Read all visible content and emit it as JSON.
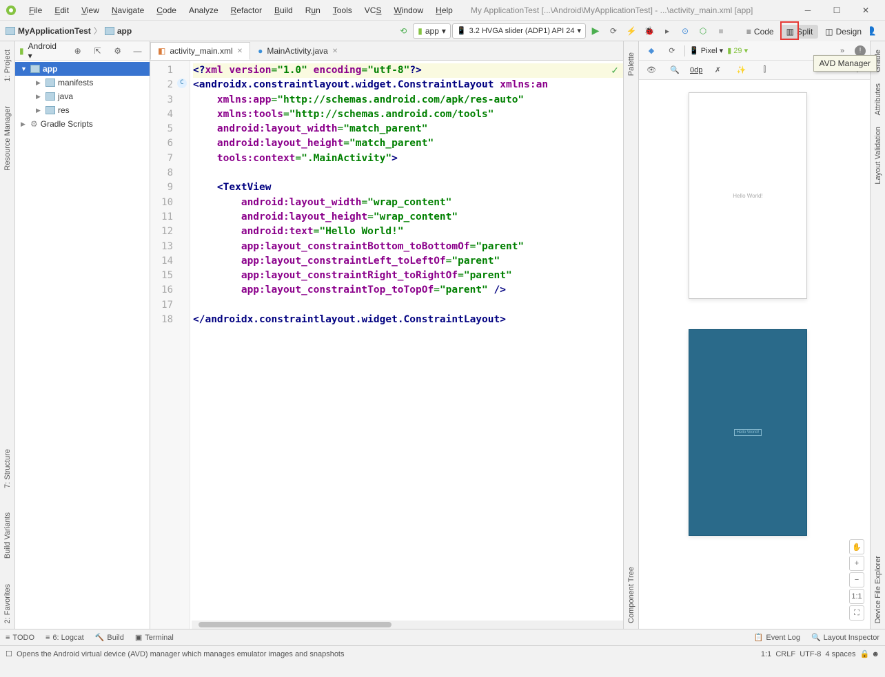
{
  "menu": {
    "file": "File",
    "edit": "Edit",
    "view": "View",
    "navigate": "Navigate",
    "code": "Code",
    "analyze": "Analyze",
    "refactor": "Refactor",
    "build": "Build",
    "run": "Run",
    "tools": "Tools",
    "vcs": "VCS",
    "window": "Window",
    "help": "Help"
  },
  "window_title": "My ApplicationTest [...\\Android\\MyApplicationTest] - ...\\activity_main.xml [app]",
  "breadcrumb": {
    "root": "MyApplicationTest",
    "module": "app"
  },
  "run_config": "app",
  "device": "3.2  HVGA slider (ADP1)  API 24",
  "tooltip": "AVD Manager",
  "project": {
    "scope": "Android",
    "root": "app",
    "children": [
      "manifests",
      "java",
      "res"
    ],
    "gradle": "Gradle Scripts"
  },
  "tabs": [
    {
      "name": "activity_main.xml",
      "active": true
    },
    {
      "name": "MainActivity.java",
      "active": false
    }
  ],
  "view_tabs": {
    "code": "Code",
    "split": "Split",
    "design": "Design"
  },
  "lines": [
    "1",
    "2",
    "3",
    "4",
    "5",
    "6",
    "7",
    "8",
    "9",
    "10",
    "11",
    "12",
    "13",
    "14",
    "15",
    "16",
    "17",
    "18"
  ],
  "code": {
    "l1_a": "<?",
    "l1_b": "xml version",
    "l1_c": "=",
    "l1_d": "\"1.0\"",
    "l1_e": " encoding",
    "l1_f": "=",
    "l1_g": "\"utf-8\"",
    "l1_h": "?>",
    "l2_a": "<",
    "l2_b": "androidx.constraintlayout.widget.ConstraintLayout",
    "l2_c": " xmlns:an",
    "l3_a": "    xmlns:app",
    "l3_b": "=",
    "l3_c": "\"http://schemas.android.com/apk/res-auto\"",
    "l4_a": "    xmlns:tools",
    "l4_b": "=",
    "l4_c": "\"http://schemas.android.com/tools\"",
    "l5_a": "    android:layout_width",
    "l5_b": "=",
    "l5_c": "\"match_parent\"",
    "l6_a": "    android:layout_height",
    "l6_b": "=",
    "l6_c": "\"match_parent\"",
    "l7_a": "    tools:context",
    "l7_b": "=",
    "l7_c": "\".MainActivity\"",
    "l7_d": ">",
    "l9_a": "    <",
    "l9_b": "TextView",
    "l10_a": "        android:layout_width",
    "l10_b": "=",
    "l10_c": "\"wrap_content\"",
    "l11_a": "        android:layout_height",
    "l11_b": "=",
    "l11_c": "\"wrap_content\"",
    "l12_a": "        android:text",
    "l12_b": "=",
    "l12_c": "\"Hello World!\"",
    "l13_a": "        app:layout_constraintBottom_toBottomOf",
    "l13_b": "=",
    "l13_c": "\"parent\"",
    "l14_a": "        app:layout_constraintLeft_toLeftOf",
    "l14_b": "=",
    "l14_c": "\"parent\"",
    "l15_a": "        app:layout_constraintRight_toRightOf",
    "l15_b": "=",
    "l15_c": "\"parent\"",
    "l16_a": "        app:layout_constraintTop_toTopOf",
    "l16_b": "=",
    "l16_c": "\"parent\"",
    "l16_d": " />",
    "l18_a": "</",
    "l18_b": "androidx.constraintlayout.widget.ConstraintLayout",
    "l18_c": ">"
  },
  "design": {
    "device": "Pixel",
    "api": "29",
    "dp": "0dp",
    "preview_text": "Hello World!",
    "one_to_one": "1:1"
  },
  "left_tools": {
    "project": "1: Project",
    "resmgr": "Resource Manager",
    "structure": "7: Structure",
    "buildvar": "Build Variants",
    "favorites": "2: Favorites"
  },
  "right_tools": {
    "gradle": "Gradle",
    "attributes": "Attributes",
    "layoutval": "Layout Validation",
    "devexplorer": "Device File Explorer",
    "palette": "Palette",
    "comptree": "Component Tree"
  },
  "bottom_tools": {
    "todo": "TODO",
    "logcat": "6: Logcat",
    "build": "Build",
    "terminal": "Terminal",
    "eventlog": "Event Log",
    "layoutinsp": "Layout Inspector"
  },
  "statusbar": {
    "hint": "Opens the Android virtual device (AVD) manager which manages emulator images and snapshots",
    "pos": "1:1",
    "lineend": "CRLF",
    "encoding": "UTF-8",
    "indent": "4 spaces"
  }
}
